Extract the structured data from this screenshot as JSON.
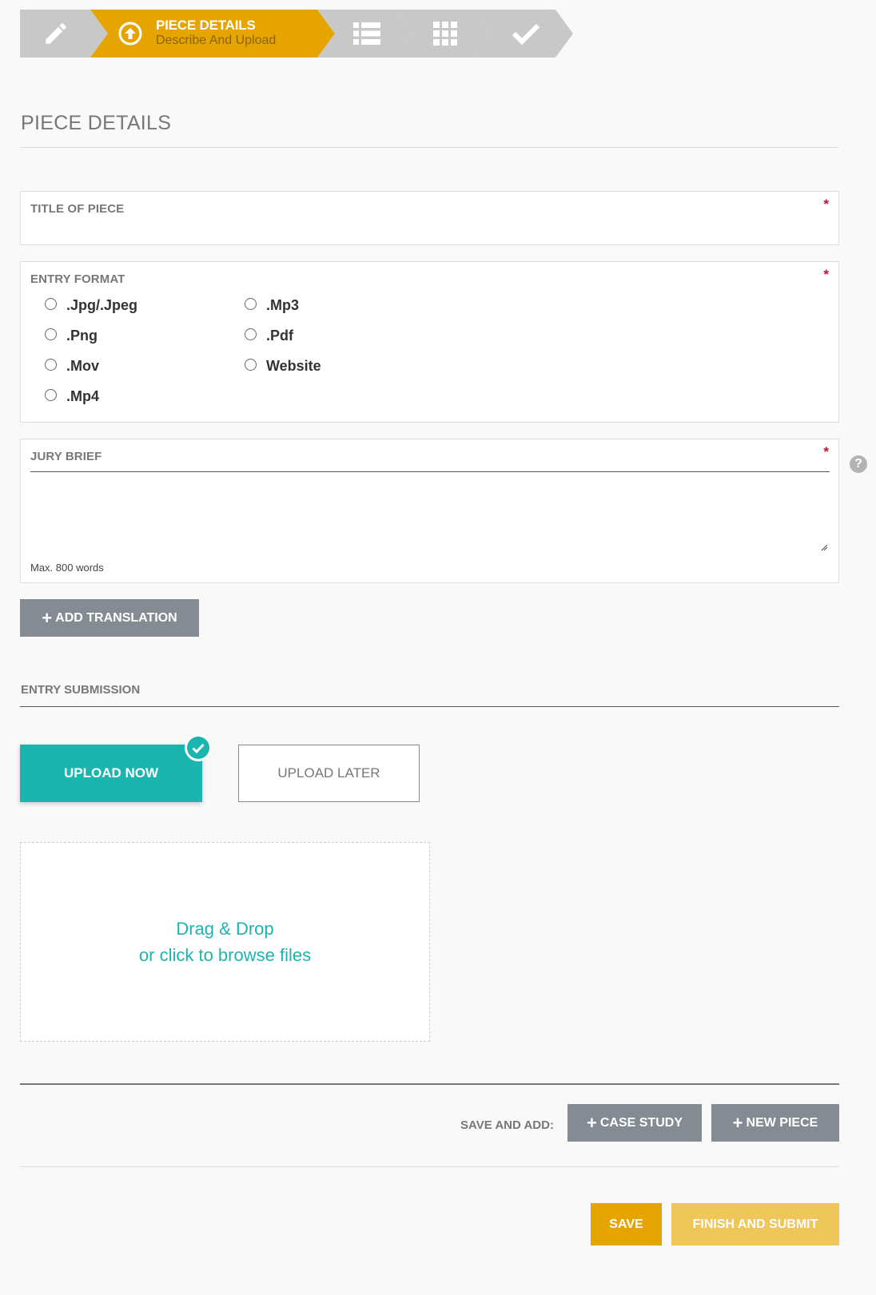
{
  "stepper": {
    "active_title": "PIECE DETAILS",
    "active_subtitle": "Describe And Upload",
    "colors": {
      "active": "#e5a400",
      "inactive": "#c8c8c8"
    }
  },
  "page": {
    "section_title": "PIECE DETAILS"
  },
  "title_field": {
    "label": "TITLE OF PIECE",
    "required_mark": "*"
  },
  "entry_format": {
    "label": "ENTRY FORMAT",
    "required_mark": "*",
    "options": [
      ".Jpg/.Jpeg",
      ".Png",
      ".Mov",
      ".Mp4",
      ".Mp3",
      ".Pdf",
      "Website"
    ]
  },
  "jury_brief": {
    "label": "JURY BRIEF",
    "required_mark": "*",
    "hint": "Max. 800 words"
  },
  "help": {
    "glyph": "?"
  },
  "add_translation": {
    "label": "ADD TRANSLATION"
  },
  "entry_submission": {
    "label": "ENTRY SUBMISSION",
    "upload_now": "UPLOAD NOW",
    "upload_later": "UPLOAD LATER",
    "selected": "UPLOAD NOW"
  },
  "dropzone": {
    "line1": "Drag & Drop",
    "line2": "or click to browse files"
  },
  "save_and_add": {
    "label": "SAVE AND ADD:",
    "case_study": "CASE STUDY",
    "new_piece": "NEW PIECE"
  },
  "footer": {
    "save": "SAVE",
    "finish": "FINISH AND SUBMIT"
  },
  "colors": {
    "accent_teal": "#1bb5b0",
    "accent_gold": "#e5a400",
    "gray_button": "#858b93",
    "required": "#c8102e"
  }
}
